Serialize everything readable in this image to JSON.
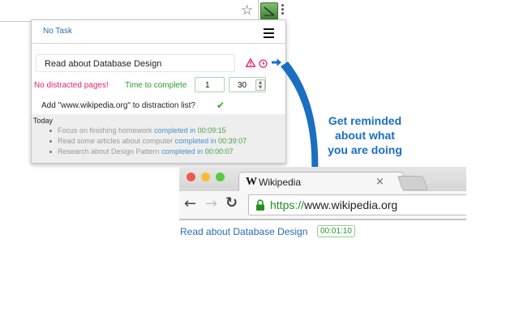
{
  "popup": {
    "task_title": "No Task",
    "task_input_value": "Read about Database Design",
    "distraction_status": "No distracted pages!",
    "time_label": "Time to complete",
    "hours_value": "1",
    "minutes_value": "30",
    "add_prompt": "Add \"www.wikipedia.org\" to distraction list?",
    "history_heading": "Today",
    "history": [
      {
        "task": "Focus on finishing homework",
        "status": "completed in",
        "time": "00:09:15"
      },
      {
        "task": "Read some articles about computer",
        "status": "completed in",
        "time": "00:39:07"
      },
      {
        "task": "Research about Design Pattern",
        "status": "completed in",
        "time": "00:00:07"
      }
    ]
  },
  "callout": {
    "lines": [
      "Get reminded",
      "about what",
      "you are doing"
    ]
  },
  "browser": {
    "tab_favicon": "W",
    "tab_title": "Wikipedia",
    "url_scheme": "https://",
    "url_host": "www.wikipedia.org"
  },
  "page_overlay": {
    "task_text": "Read about Database Design",
    "timer": "00:01:10"
  },
  "colors": {
    "accent_blue": "#1a6fc0",
    "task_blue": "#2a6db5",
    "distraction_pink": "#e0207a",
    "time_green": "#2e9a2e"
  },
  "icons": {
    "bookmark": "star-icon",
    "extension": "extension-icon",
    "browser_menu": "kebab-menu-icon",
    "popup_menu": "hamburger-menu-icon",
    "warning": "warning-triangle-icon",
    "timer": "clock-icon",
    "start": "arrow-right-icon",
    "confirm": "checkmark-icon",
    "secure": "lock-icon"
  }
}
